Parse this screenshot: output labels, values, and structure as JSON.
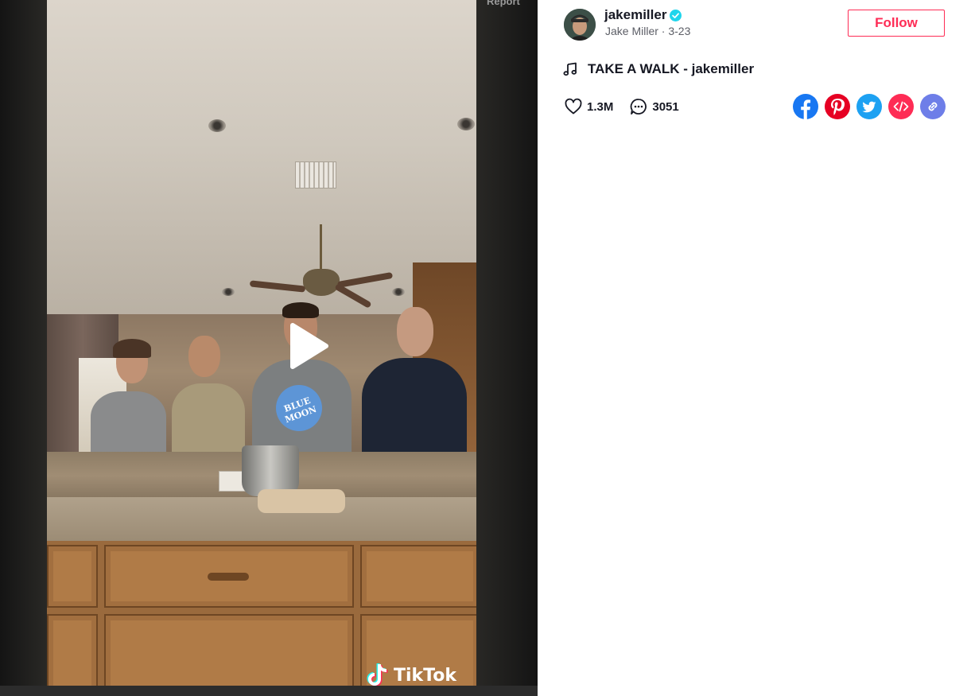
{
  "video": {
    "report_label": "Report",
    "watermark_text": "TikTok",
    "play_icon": "play-icon",
    "shirt_text": "BLUE MOON"
  },
  "author": {
    "username": "jakemiller",
    "display_name": "Jake Miller",
    "separator": " · ",
    "date": "3-23",
    "verified": true,
    "verified_icon": "verified-badge-icon"
  },
  "follow_label": "Follow",
  "music": {
    "icon": "music-note-icon",
    "title": "TAKE A WALK - jakemiller"
  },
  "stats": {
    "likes": "1.3M",
    "comments": "3051"
  },
  "share": [
    {
      "name": "facebook-share-icon",
      "color": "#1877f2"
    },
    {
      "name": "pinterest-share-icon",
      "color": "#e60023"
    },
    {
      "name": "twitter-share-icon",
      "color": "#1da1f2"
    },
    {
      "name": "embed-code-icon",
      "color": "#fe2c55"
    },
    {
      "name": "copy-link-icon",
      "color": "#6e7ee8"
    }
  ],
  "colors": {
    "accent": "#fe2c55",
    "text_primary": "#161823",
    "text_secondary": "#5c5e66"
  }
}
